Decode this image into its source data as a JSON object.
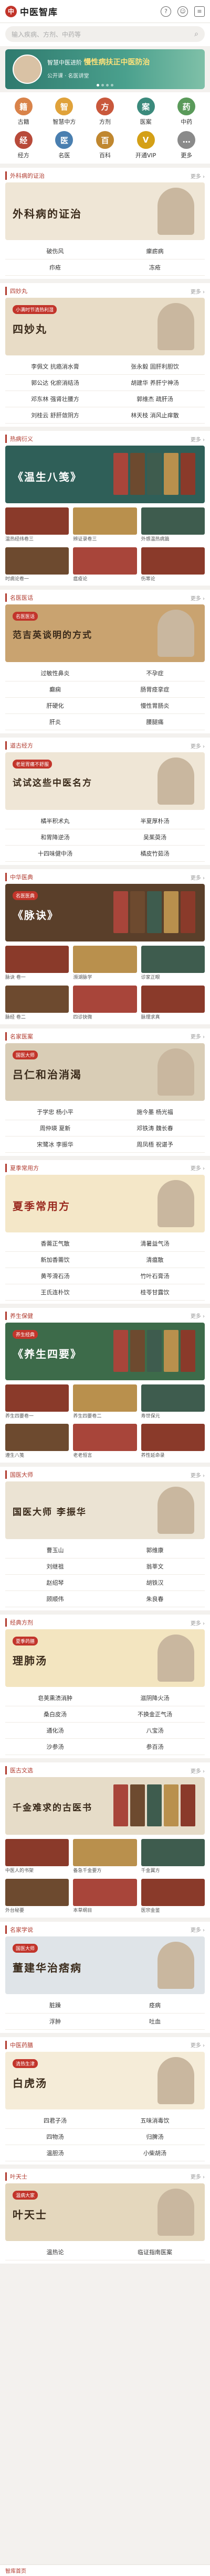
{
  "app": {
    "logo_mark": "中",
    "title": "中医智库"
  },
  "search": {
    "placeholder": "输入疾病、方剂、中药等"
  },
  "banner": {
    "line1_prefix": "智慧中医进阶",
    "line1_hl": "慢性病扶正中医防治",
    "line2": "公开课 · 名医讲堂"
  },
  "nav": [
    {
      "label": "古籍",
      "icon": "book-icon",
      "color": "#d9834a",
      "glyph": "籍"
    },
    {
      "label": "智慧中方",
      "icon": "wisdom-icon",
      "color": "#e0a23a",
      "glyph": "智"
    },
    {
      "label": "方剂",
      "icon": "formula-icon",
      "color": "#c9583c",
      "glyph": "方"
    },
    {
      "label": "医案",
      "icon": "case-icon",
      "color": "#3b8a7c",
      "glyph": "案"
    },
    {
      "label": "中药",
      "icon": "herb-icon",
      "color": "#5a9a5a",
      "glyph": "药"
    },
    {
      "label": "经方",
      "icon": "classic-icon",
      "color": "#b84a3a",
      "glyph": "经"
    },
    {
      "label": "名医",
      "icon": "doctor-icon",
      "color": "#4a7fb0",
      "glyph": "医"
    },
    {
      "label": "百科",
      "icon": "wiki-icon",
      "color": "#c0872f",
      "glyph": "百"
    },
    {
      "label": "开通VIP",
      "icon": "vip-icon",
      "color": "#d4a017",
      "glyph": "V"
    },
    {
      "label": "更多",
      "icon": "more-icon",
      "color": "#8a8a8a",
      "glyph": "…"
    }
  ],
  "sections": [
    {
      "title": "外科病的证治",
      "more": "更多 ›",
      "hero_title": "外科病的证治",
      "hero_tag": "",
      "bg": "#efe6d6",
      "fg": "#3a2a1a",
      "kind": "items",
      "items": [
        "破伤风",
        "瘰疬病",
        "疖疮",
        "冻疮"
      ]
    },
    {
      "title": "四妙丸",
      "more": "更多 ›",
      "hero_title": "四妙丸",
      "hero_tag": "小满时节清热利湿",
      "bg": "#e8dcc6",
      "fg": "#3a2a1a",
      "kind": "items",
      "items": [
        "李佩文 抗癌消水膏",
        "张永毅 固肝利胆饮",
        "郭公达 化瘀消结汤",
        "胡建华 养肝宁神汤",
        "邓东林 强肾壮腰方",
        "郭维杰 疏肝汤",
        "刘桂云 舒肝敛阴方",
        "林天枝 消风止痒散"
      ]
    },
    {
      "title": "热病衍义",
      "more": "更多 ›",
      "hero_title": "《温生八笺》",
      "hero_tag": "",
      "bg": "#2f5f58",
      "fg": "#ffffff",
      "kind": "cards",
      "cards": [
        "温热经纬卷三",
        "辨证录卷三",
        "外感温热病篇",
        "时病论卷一",
        "瘟疫论",
        "伤寒论"
      ]
    },
    {
      "title": "名医医话",
      "more": "更多 ›",
      "hero_title": "范吉英谈明的方式",
      "hero_tag": "名医医话",
      "bg": "#c9a370",
      "fg": "#3a2a1a",
      "kind": "items",
      "items": [
        "过敏性鼻炎",
        "不孕症",
        "癫痫",
        "肠胃痉挛症",
        "肝硬化",
        "慢性胃肠炎",
        "肝炎",
        "腰腿痛"
      ]
    },
    {
      "title": "道古经方",
      "more": "更多 ›",
      "hero_title": "试试这些中医名方",
      "hero_tag": "老是胃痛不舒服",
      "bg": "#efe6d6",
      "fg": "#3a2a1a",
      "kind": "items",
      "items": [
        "橘半积术丸",
        "半夏厚朴汤",
        "和胃降逆汤",
        "吴茱萸汤",
        "十四味健中汤",
        "橘皮竹茹汤"
      ]
    },
    {
      "title": "中华医典",
      "more": "更多 ›",
      "hero_title": "《脉诀》",
      "hero_tag": "名医医典",
      "bg": "#5a3f2a",
      "fg": "#ffffff",
      "kind": "cards",
      "cards": [
        "脉诀 卷一",
        "濒湖脉学",
        "诊家正眼",
        "脉经 卷二",
        "四诊抉微",
        "脉理求真"
      ]
    },
    {
      "title": "名家医案",
      "more": "更多 ›",
      "hero_title": "吕仁和治消渴",
      "hero_tag": "国医大师",
      "bg": "#d9cdb6",
      "fg": "#3a2a1a",
      "kind": "items",
      "items": [
        "于学忠 杨小平",
        "施今墨 杨光福",
        "周仲瑛 夏新",
        "邓铁涛 魏长春",
        "宋鹭冰 李振华",
        "周凤梧 祝谌予"
      ]
    },
    {
      "title": "夏季常用方",
      "more": "更多 ›",
      "hero_title": "夏季常用方",
      "hero_tag": "",
      "bg": "#f4e7c8",
      "fg": "#9a2a1f",
      "kind": "items",
      "items": [
        "香薷正气散",
        "清暑益气汤",
        "新加香薷饮",
        "清瘟散",
        "黄芩滑石汤",
        "竹叶石膏汤",
        "王氏连朴饮",
        "桂苓甘露饮"
      ]
    },
    {
      "title": "养生保健",
      "more": "更多 ›",
      "hero_title": "《养生四要》",
      "hero_tag": "养生经典",
      "bg": "#3d6b4a",
      "fg": "#ffffff",
      "kind": "cards",
      "cards": [
        "养生四要卷一",
        "养生四要卷二",
        "寿世保元",
        "遵生八笺",
        "老老恒言",
        "养性延命录"
      ]
    },
    {
      "title": "国医大师",
      "more": "更多 ›",
      "hero_title": "国医大师 李振华",
      "hero_tag": "",
      "bg": "#ebe3d3",
      "fg": "#3a2a1a",
      "kind": "items",
      "items": [
        "曹玉山",
        "郭维康",
        "刘继祖",
        "翁莘文",
        "赵绍琴",
        "胡铁汉",
        "顾顺伟",
        "朱良春"
      ]
    },
    {
      "title": "经典方剂",
      "more": "更多 ›",
      "hero_title": "理肺汤",
      "hero_tag": "夏季药膳",
      "bg": "#f3e5c0",
      "fg": "#3a2a1a",
      "kind": "items",
      "items": [
        "皂荚熏渍消肿",
        "滋阴降火汤",
        "桑白皮汤",
        "不换金正气汤",
        "通化汤",
        "八宝汤",
        "沙参汤",
        "参百汤"
      ]
    },
    {
      "title": "医古文选",
      "more": "更多 ›",
      "hero_title": "千金难求的古医书",
      "hero_tag": "",
      "bg": "#e6dcc8",
      "fg": "#3a2a1a",
      "kind": "cards",
      "cards": [
        "中医人的书架",
        "备急千金要方",
        "千金翼方",
        "外台秘要",
        "本草纲目",
        "医宗金鉴"
      ]
    },
    {
      "title": "名家学说",
      "more": "更多 ›",
      "hero_title": "董建华治痞病",
      "hero_tag": "国医大师",
      "bg": "#dfe4e8",
      "fg": "#3a2a1a",
      "kind": "items",
      "items": [
        "脏躁",
        "痉病",
        "浮肿",
        "吐血"
      ]
    },
    {
      "title": "中医药膳",
      "more": "更多 ›",
      "hero_title": "白虎汤",
      "hero_tag": "清热生津",
      "bg": "#f5ecd8",
      "fg": "#3a2a1a",
      "kind": "items",
      "items": [
        "四君子汤",
        "五味消毒饮",
        "四物汤",
        "归脾汤",
        "温胆汤",
        "小柴胡汤"
      ]
    },
    {
      "title": "叶天士",
      "more": "更多 ›",
      "hero_title": "叶天士",
      "hero_tag": "温病大家",
      "bg": "#e4d7bd",
      "fg": "#3a2a1a",
      "kind": "items",
      "items": [
        "温热论",
        "临证指南医案"
      ]
    }
  ],
  "footer": {
    "label": "智库首页"
  }
}
